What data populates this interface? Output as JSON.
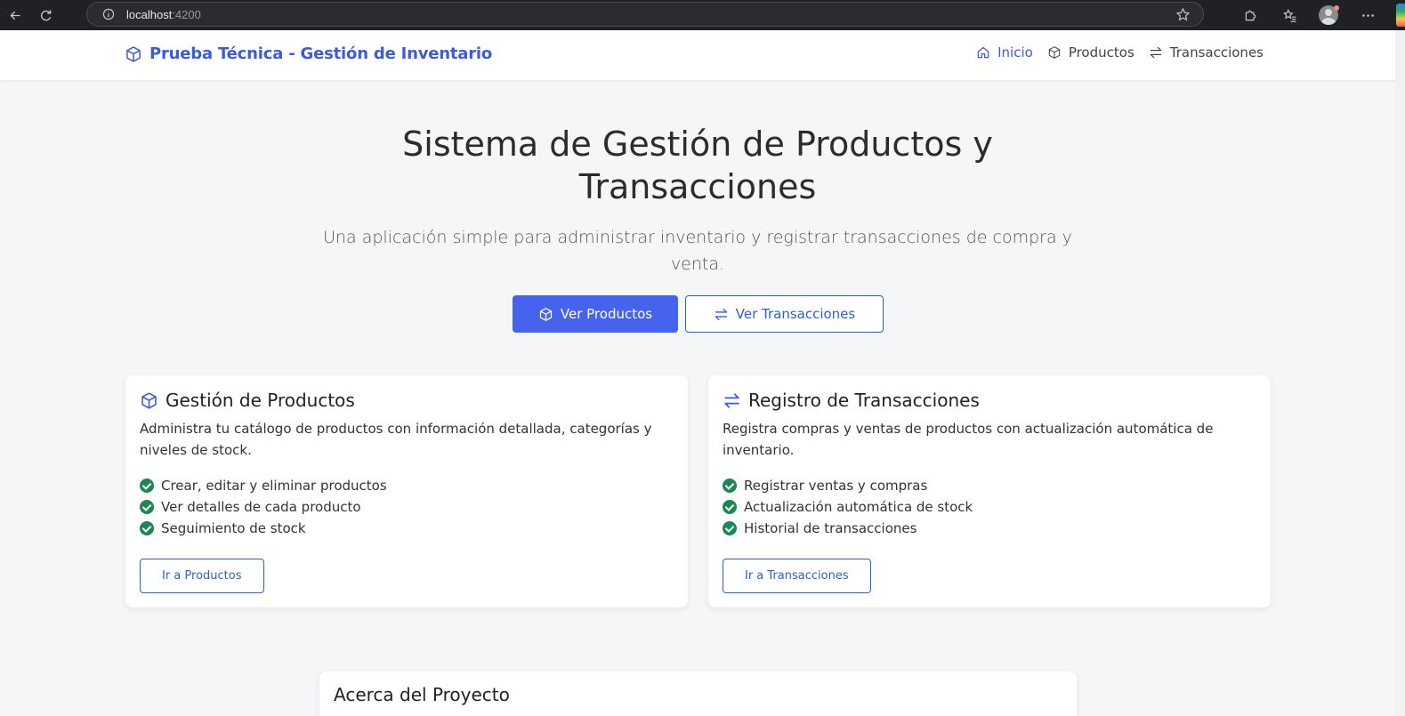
{
  "browser": {
    "url_host": "localhost",
    "url_port": ":4200"
  },
  "navbar": {
    "brand": "Prueba Técnica - Gestión de Inventario",
    "links": [
      {
        "label": "Inicio",
        "icon": "home-icon",
        "active": true
      },
      {
        "label": "Productos",
        "icon": "box-icon",
        "active": false
      },
      {
        "label": "Transacciones",
        "icon": "arrows-exchange-icon",
        "active": false
      }
    ]
  },
  "hero": {
    "title": "Sistema de Gestión de Productos y Transacciones",
    "subtitle": "Una aplicación simple para administrar inventario y registrar transacciones de compra y venta.",
    "primary_button": "Ver Productos",
    "secondary_button": "Ver Transacciones"
  },
  "cards": [
    {
      "title": "Gestión de Productos",
      "description": "Administra tu catálogo de productos con información detallada, categorías y niveles de stock.",
      "features": [
        "Crear, editar y eliminar productos",
        "Ver detalles de cada producto",
        "Seguimiento de stock"
      ],
      "button": "Ir a Productos"
    },
    {
      "title": "Registro de Transacciones",
      "description": "Registra compras y ventas de productos con actualización automática de inventario.",
      "features": [
        "Registrar ventas y compras",
        "Actualización automática de stock",
        "Historial de transacciones"
      ],
      "button": "Ir a Transacciones"
    }
  ],
  "about": {
    "title": "Acerca del Proyecto"
  },
  "colors": {
    "accent": "#3d5bd9",
    "primary_button": "#4663ee",
    "success": "#1c8754",
    "background": "#f5f6f8"
  }
}
